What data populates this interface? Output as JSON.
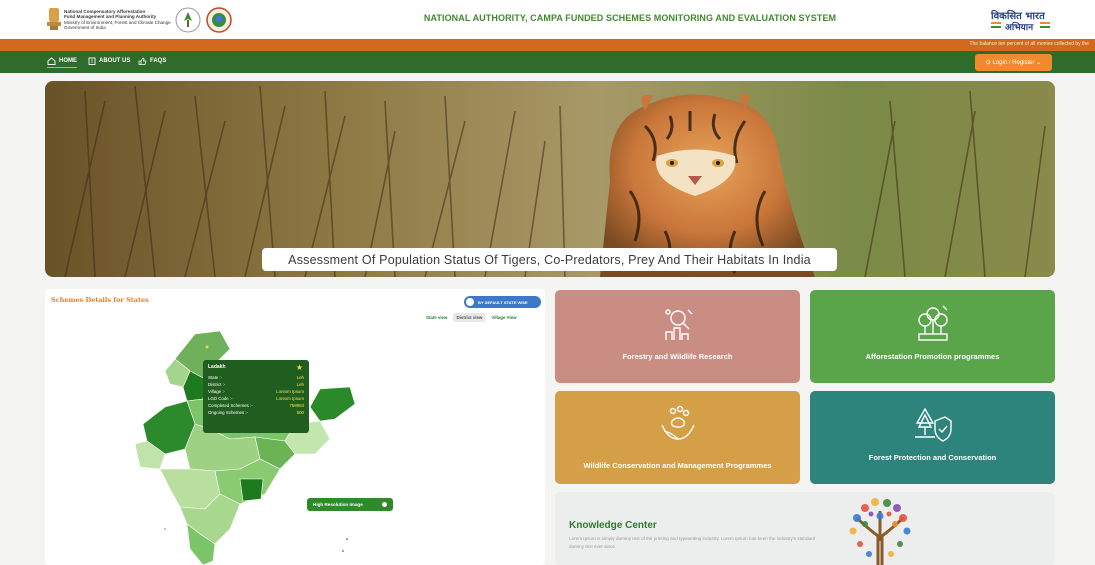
{
  "header": {
    "org_lines": [
      "National Compensatory Afforestation",
      "Fund Management and Planning Authority",
      "Ministry of Environment, Forest and Climate Change",
      "Government of India"
    ],
    "site_title": "NATIONAL AUTHORITY, CAMPA FUNDED SCHEMES MONITORING AND EVALUATION SYSTEM",
    "viksit_logo_text": "विकसित भारत अभियान"
  },
  "ticker": {
    "text": "The balance ten percent of all monies collected by the"
  },
  "nav": {
    "items": [
      {
        "label": "HOME",
        "icon": "home-icon"
      },
      {
        "label": "ABOUT US",
        "icon": "building-icon"
      },
      {
        "label": "FAQS",
        "icon": "thumbs-up-icon"
      }
    ],
    "login_label": "⊙ Login / Register ⌄"
  },
  "banner": {
    "caption": "Assessment Of Population Status Of Tigers, Co-Predators, Prey And Their Habitats In India"
  },
  "map_panel": {
    "heading": "Schemes Details for States",
    "default_toggle": "BY DEFAULT STATE WISE",
    "views": [
      "State view",
      "District view",
      "Village View"
    ],
    "tooltip": {
      "title": "Ladakh",
      "rows": [
        {
          "k": "State :-",
          "v": "Leh"
        },
        {
          "k": "District :-",
          "v": "Leh"
        },
        {
          "k": "Village :-",
          "v": "Lorexm Ipsum"
        },
        {
          "k": "LGD Code :-",
          "v": "Lorexm Ipsum"
        },
        {
          "k": "Completed Schemes :-",
          "v": "758963"
        },
        {
          "k": "Ongoing Schemes :-",
          "v": "500"
        }
      ]
    },
    "hires_label": "High Resolution Image"
  },
  "cards": [
    {
      "label": "Forestry and Wildlife Research",
      "icon": "research-icon"
    },
    {
      "label": "Afforestation Promotion programmes",
      "icon": "afforestation-icon"
    },
    {
      "label": "Wildlife Conservation and Management Programmes",
      "icon": "wildlife-icon"
    },
    {
      "label": "Forest Protection and Conservation",
      "icon": "forest-shield-icon"
    }
  ],
  "knowledge": {
    "title": "Knowledge Center",
    "desc": "Lorem Ipsum is simply dummy text of the printing and typesetting industry. Lorem Ipsum has been the industry's standard dummy text ever since."
  },
  "colors": {
    "nav": "#2f6b2a",
    "ticker": "#d2691e",
    "login": "#f08a2c",
    "title": "#3f8a2e"
  }
}
